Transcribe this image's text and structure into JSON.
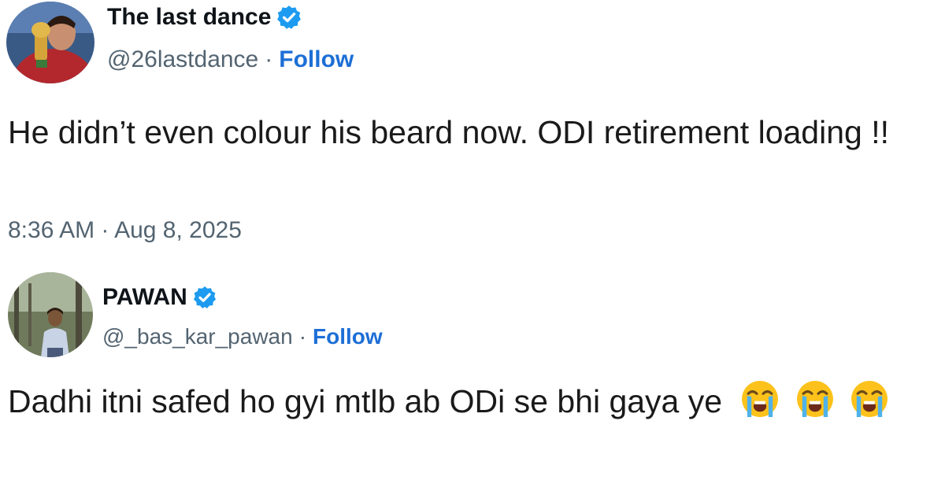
{
  "posts": [
    {
      "author": {
        "display_name": "The last dance",
        "handle": "@26lastdance",
        "verified": true,
        "avatar_icon": "profile-photo-player-with-trophy"
      },
      "separator": "·",
      "follow_label": "Follow",
      "text": "He didn’t even colour his beard now. ODI retirement loading !!",
      "timestamp": "8:36 AM · Aug 8, 2025"
    },
    {
      "author": {
        "display_name": "PAWAN",
        "handle": "@_bas_kar_pawan",
        "verified": true,
        "avatar_icon": "profile-photo-man-outdoors"
      },
      "separator": "·",
      "follow_label": "Follow",
      "text": "Dadhi itni safed ho gyi mtlb ab ODi se bhi gaya ye",
      "emoji": [
        "loudly-crying-face",
        "loudly-crying-face",
        "loudly-crying-face"
      ]
    }
  ],
  "colors": {
    "follow": "#1d6fd6",
    "verified_badge": "#1d9bf0",
    "secondary_text": "#536471"
  }
}
